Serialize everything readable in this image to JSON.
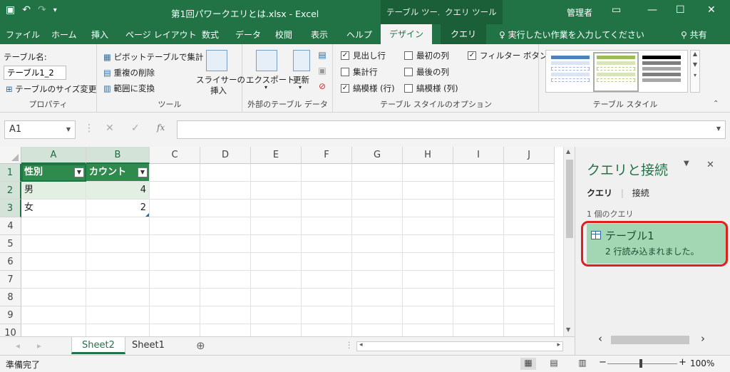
{
  "titlebar": {
    "title": "第1回パワークエリとは.xlsx - Excel",
    "ctx_table_tools": "テーブル ツール",
    "ctx_query_tools": "クエリ ツール",
    "user": "管理者"
  },
  "tabs": {
    "file": "ファイル",
    "home": "ホーム",
    "insert": "挿入",
    "page_layout": "ページ レイアウト",
    "formulas": "数式",
    "data": "データ",
    "review": "校閲",
    "view": "表示",
    "help": "ヘルプ",
    "design": "デザイン",
    "query": "クエリ",
    "tell_me": "実行したい作業を入力してください",
    "share": "共有"
  },
  "ribbon": {
    "properties": {
      "label": "テーブル名:",
      "table_name": "テーブル1_2",
      "resize": "テーブルのサイズ変更",
      "group": "プロパティ"
    },
    "tools": {
      "pivot": "ピボットテーブルで集計",
      "remove_dup": "重複の削除",
      "convert": "範囲に変換",
      "slicer": "スライサーの",
      "slicer2": "挿入",
      "group": "ツール"
    },
    "external": {
      "export": "エクスポート",
      "refresh": "更新",
      "group": "外部のテーブル データ"
    },
    "style_options": {
      "header_row": "見出し行",
      "total_row": "集計行",
      "banded_rows": "縞模様 (行)",
      "first_col": "最初の列",
      "last_col": "最後の列",
      "banded_cols": "縞模様 (列)",
      "filter_btn": "フィルター ボタン",
      "group": "テーブル スタイルのオプション"
    },
    "styles": {
      "group": "テーブル スタイル"
    }
  },
  "formula_bar": {
    "name_box": "A1",
    "fx": "fx"
  },
  "grid": {
    "columns": [
      "A",
      "B",
      "C",
      "D",
      "E",
      "F",
      "G",
      "H",
      "I",
      "J"
    ],
    "rows": [
      "1",
      "2",
      "3",
      "4",
      "5",
      "6",
      "7",
      "8",
      "9",
      "10"
    ],
    "table": {
      "headers": [
        "性別",
        "カウント"
      ],
      "rows": [
        [
          "男",
          "4"
        ],
        [
          "女",
          "2"
        ]
      ]
    }
  },
  "sheets": {
    "tabs": [
      "Sheet2",
      "Sheet1"
    ],
    "active": "Sheet2"
  },
  "status": {
    "ready": "準備完了",
    "zoom": "100%"
  },
  "query_pane": {
    "title": "クエリと接続",
    "tab_queries": "クエリ",
    "tab_connections": "接続",
    "count": "1 個のクエリ",
    "item_name": "テーブル1",
    "item_status": "2 行読み込まれました。"
  },
  "colors": {
    "brand": "#217346",
    "table_header": "#2f8a4d",
    "highlight": "#e01f1f"
  }
}
